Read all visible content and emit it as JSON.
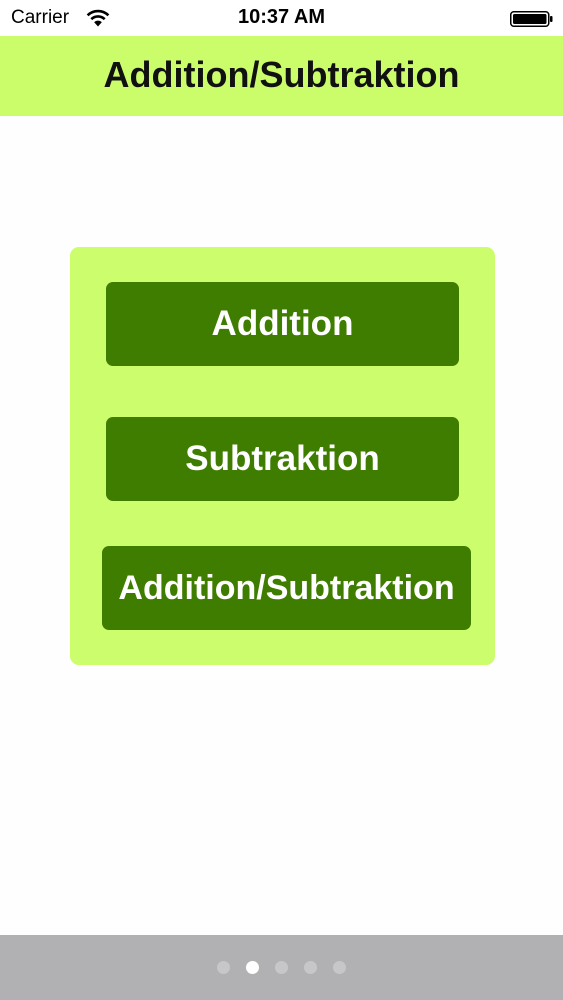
{
  "status_bar": {
    "carrier": "Carrier",
    "time": "10:37 AM",
    "wifi_icon": "wifi-icon",
    "battery_icon": "battery-icon"
  },
  "header": {
    "title": "Addition/Subtraktion",
    "background": "#cbfd6b"
  },
  "menu": {
    "panel_color": "#ccfd6c",
    "button_color": "#3f7d00",
    "buttons": [
      {
        "label": "Addition"
      },
      {
        "label": "Subtraktion"
      },
      {
        "label": "Addition/Subtraktion"
      }
    ]
  },
  "page_control": {
    "count": 5,
    "current": 2,
    "background": "#b1b1b3"
  }
}
